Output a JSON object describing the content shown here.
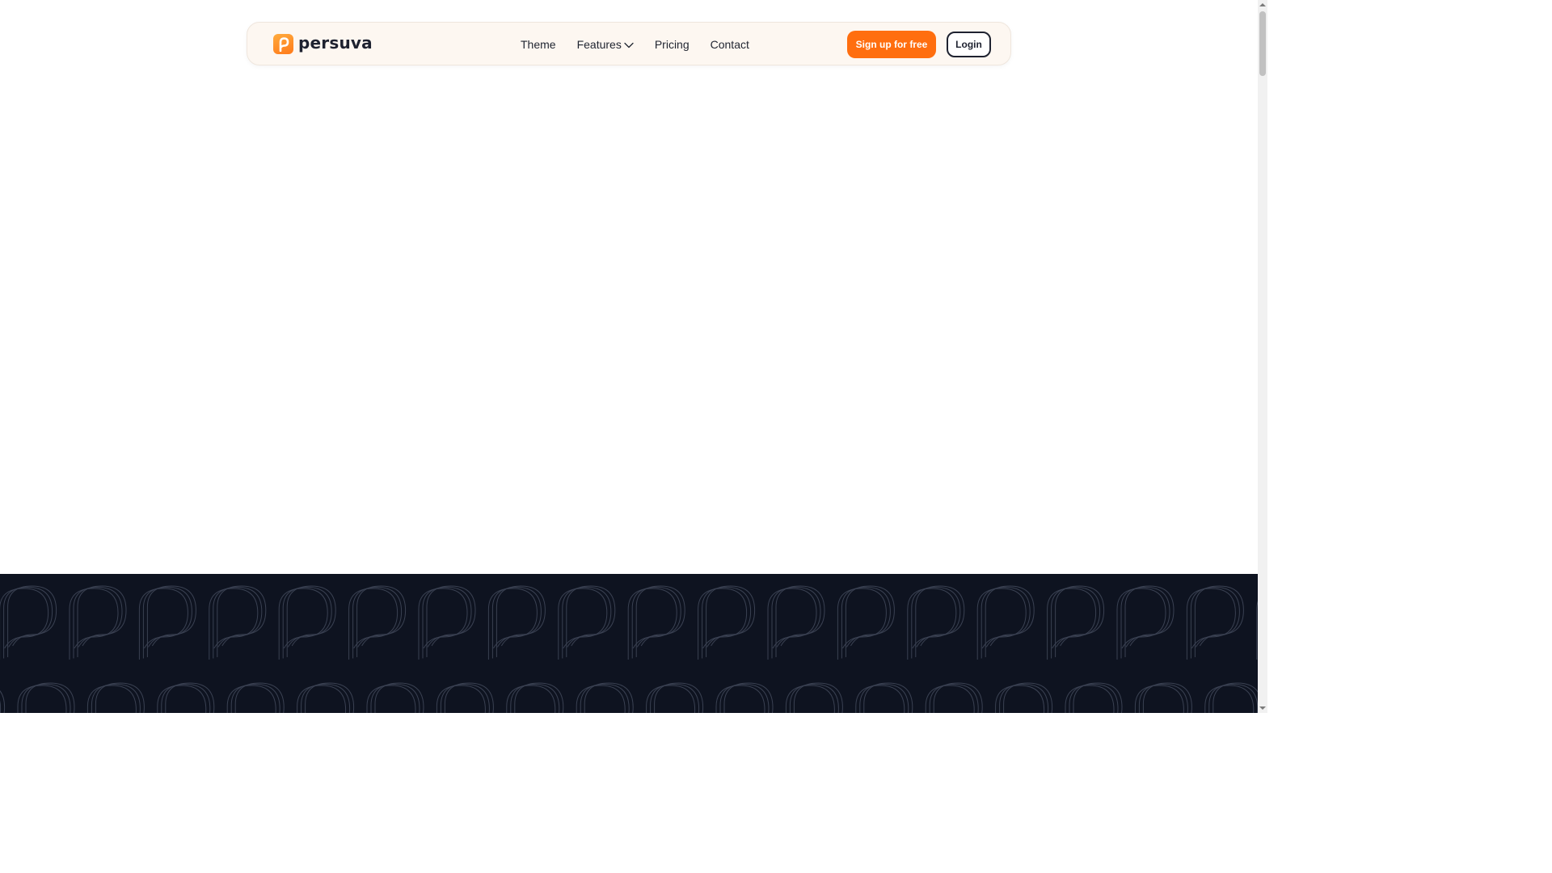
{
  "brand": {
    "name": "persuva",
    "accent": "#ff6e0f",
    "dark": "#0e1320"
  },
  "nav": {
    "items": [
      {
        "label": "Theme"
      },
      {
        "label": "Features",
        "has_dropdown": true
      },
      {
        "label": "Pricing"
      },
      {
        "label": "Contact"
      }
    ],
    "signup_label": "Sign up for free",
    "login_label": "Login"
  },
  "icons": {
    "logo": "persuva-logo-icon",
    "dropdown": "chevron-down-icon",
    "pattern": "persuva-p-pattern",
    "scroll_up": "scroll-up-arrow-icon",
    "scroll_down": "scroll-down-arrow-icon"
  }
}
